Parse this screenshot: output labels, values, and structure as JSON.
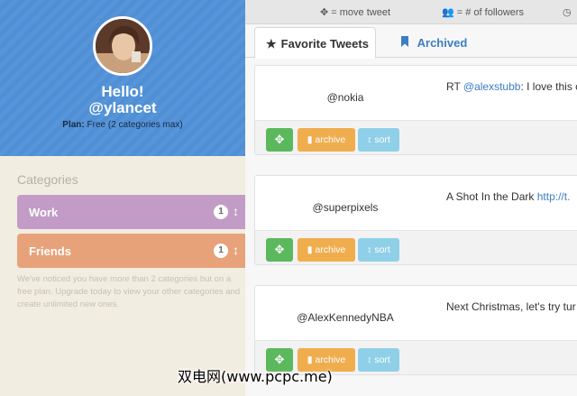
{
  "profile": {
    "greeting": "Hello!",
    "handle": "@ylancet",
    "plan_label": "Plan:",
    "plan_value": "Free (2 categories max)"
  },
  "categories": {
    "heading": "Categories",
    "items": [
      {
        "label": "Work",
        "count": "1",
        "color": "#c29cc6"
      },
      {
        "label": "Friends",
        "count": "1",
        "color": "#e8a27a"
      }
    ],
    "note": "We've noticed you have more than 2 categories but on a free plan. Upgrade today to view your other categories and create unlimited new ones."
  },
  "legend": {
    "move": "= move tweet",
    "followers": "= # of followers",
    "clock": "◷"
  },
  "tabs": [
    {
      "label": "Favorite Tweets",
      "icon": "star-icon"
    },
    {
      "label": "Archived",
      "icon": "bookmark-icon"
    }
  ],
  "tweets": [
    {
      "user": "@nokia",
      "prefix": "RT ",
      "link": "@alexstubb",
      "suffix": ": I love this c"
    },
    {
      "user": "@superpixels",
      "prefix": "A Shot In the Dark ",
      "link": "http://t.",
      "suffix": ""
    },
    {
      "user": "@AlexKennedyNBA",
      "prefix": "Next Christmas, let's try tur",
      "link": "",
      "suffix": ""
    }
  ],
  "buttons": {
    "archive": "archive",
    "sort": "sort"
  },
  "watermark": "双电网(www.pcpc.me)",
  "colors": {
    "header_blue": "#4f8fd6",
    "sidebar_bg": "#f2ede1",
    "move_green": "#5cb85c",
    "archive_orange": "#f0ad4e",
    "sort_blue": "#8fd0e8",
    "link_blue": "#3b7dc4"
  }
}
